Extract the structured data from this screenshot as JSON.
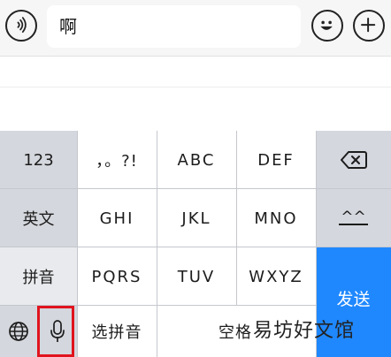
{
  "input_bar": {
    "text_value": "啊",
    "icons": [
      "voice-icon",
      "emoji-icon",
      "plus-icon"
    ]
  },
  "keyboard": {
    "left_column": [
      "123",
      "英文",
      "拼音"
    ],
    "rows": [
      [
        "，。?!",
        "ABC",
        "DEF"
      ],
      [
        "GHI",
        "JKL",
        "MNO"
      ],
      [
        "PQRS",
        "TUV",
        "WXYZ"
      ]
    ],
    "right_column": {
      "top_icon": "backspace-icon",
      "face_label": "^^",
      "send_label": "发送"
    },
    "bottom_row": {
      "globe_icon": "globe-icon",
      "mic_icon": "microphone-icon",
      "select_pinyin_label": "选拼音",
      "space_label": "空格"
    }
  },
  "watermark": "易坊好文馆",
  "colors": {
    "send_key": "#1f88ff",
    "highlight": "#e0141e",
    "keyboard_bg": "#d4d7dd"
  }
}
